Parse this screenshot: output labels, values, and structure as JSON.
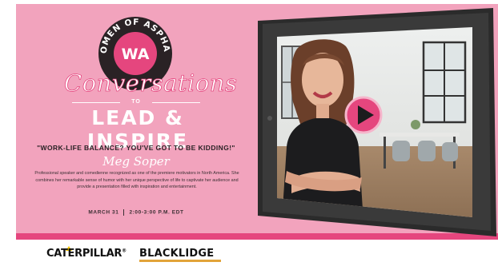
{
  "logo": {
    "text": "WOMEN OF ASPHALT",
    "initials": "WA"
  },
  "event": {
    "title_script": "Conversations",
    "title_connector": "TO",
    "title_main": "LEAD & INSPIRE",
    "session_title": "\"WORK-LIFE BALANCE? YOU'VE GOT TO BE KIDDING!\"",
    "speaker": "Meg Soper",
    "bio": "Professional speaker and comedienne recognized as one of the premiere motivators in North America. She combines her remarkable sense of humor with her unique perspective of life to captivate her audience and provide a presentation filled with inspiration and entertainment.",
    "date": "MARCH 31",
    "time": "2:00-3:00 P.M. EDT"
  },
  "video": {
    "play_label": "play"
  },
  "sponsors": {
    "caterpillar": "CATERPILLAR",
    "caterpillar_mark": "®",
    "blacklidge": "BLACKLIDGE"
  },
  "colors": {
    "banner_pink": "#f2a3bd",
    "accent_pink": "#e5467e",
    "tablet_frame": "#2b2b2b",
    "blacklidge_gold": "#e2a43a"
  }
}
